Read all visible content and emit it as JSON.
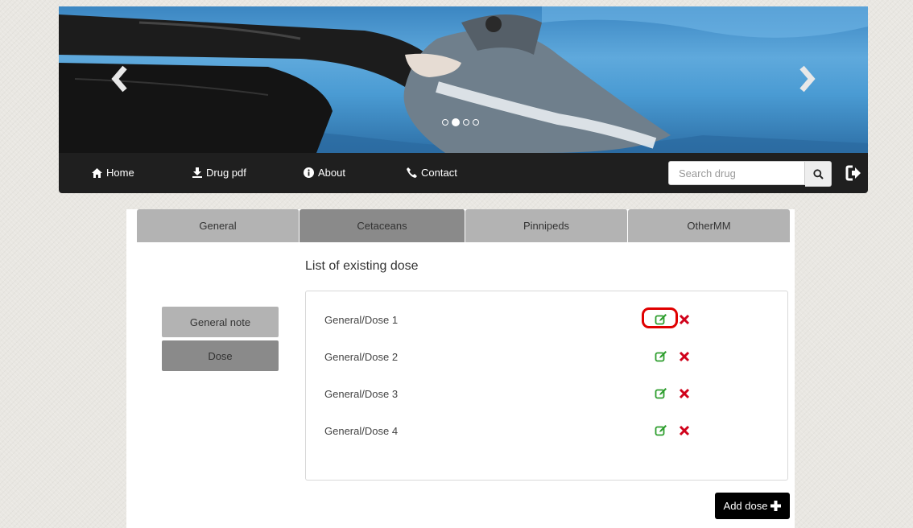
{
  "banner": {
    "prev_icon": "chevron-left-icon",
    "next_icon": "chevron-right-icon",
    "slides": 4,
    "active_slide": 2
  },
  "nav": {
    "items": [
      {
        "label": "Home",
        "icon": "home-icon"
      },
      {
        "label": "Drug pdf",
        "icon": "download-icon"
      },
      {
        "label": "About",
        "icon": "info-circle-icon"
      },
      {
        "label": "Contact",
        "icon": "phone-icon"
      }
    ],
    "search_placeholder": "Search drug",
    "search_icon": "search-icon",
    "logout_icon": "logout-icon"
  },
  "tabs": [
    "General",
    "Cetaceans",
    "Pinnipeds",
    "OtherMM"
  ],
  "active_tab": "Cetaceans",
  "sidebar": {
    "buttons": [
      "General note",
      "Dose"
    ],
    "active": "Dose"
  },
  "section_title": "List of existing dose",
  "doses": [
    {
      "label": "General/Dose 1",
      "highlighted": true
    },
    {
      "label": "General/Dose 2",
      "highlighted": false
    },
    {
      "label": "General/Dose 3",
      "highlighted": false
    },
    {
      "label": "General/Dose 4",
      "highlighted": false
    }
  ],
  "add_button": {
    "label": "Add dose",
    "icon": "plus-icon"
  },
  "colors": {
    "navbar": "#1f1f1f",
    "tab_inactive": "#b3b3b3",
    "tab_active": "#8a8a8a",
    "edit_icon": "#2e9e2e",
    "delete_icon": "#d0021b",
    "highlight": "#e00000"
  }
}
